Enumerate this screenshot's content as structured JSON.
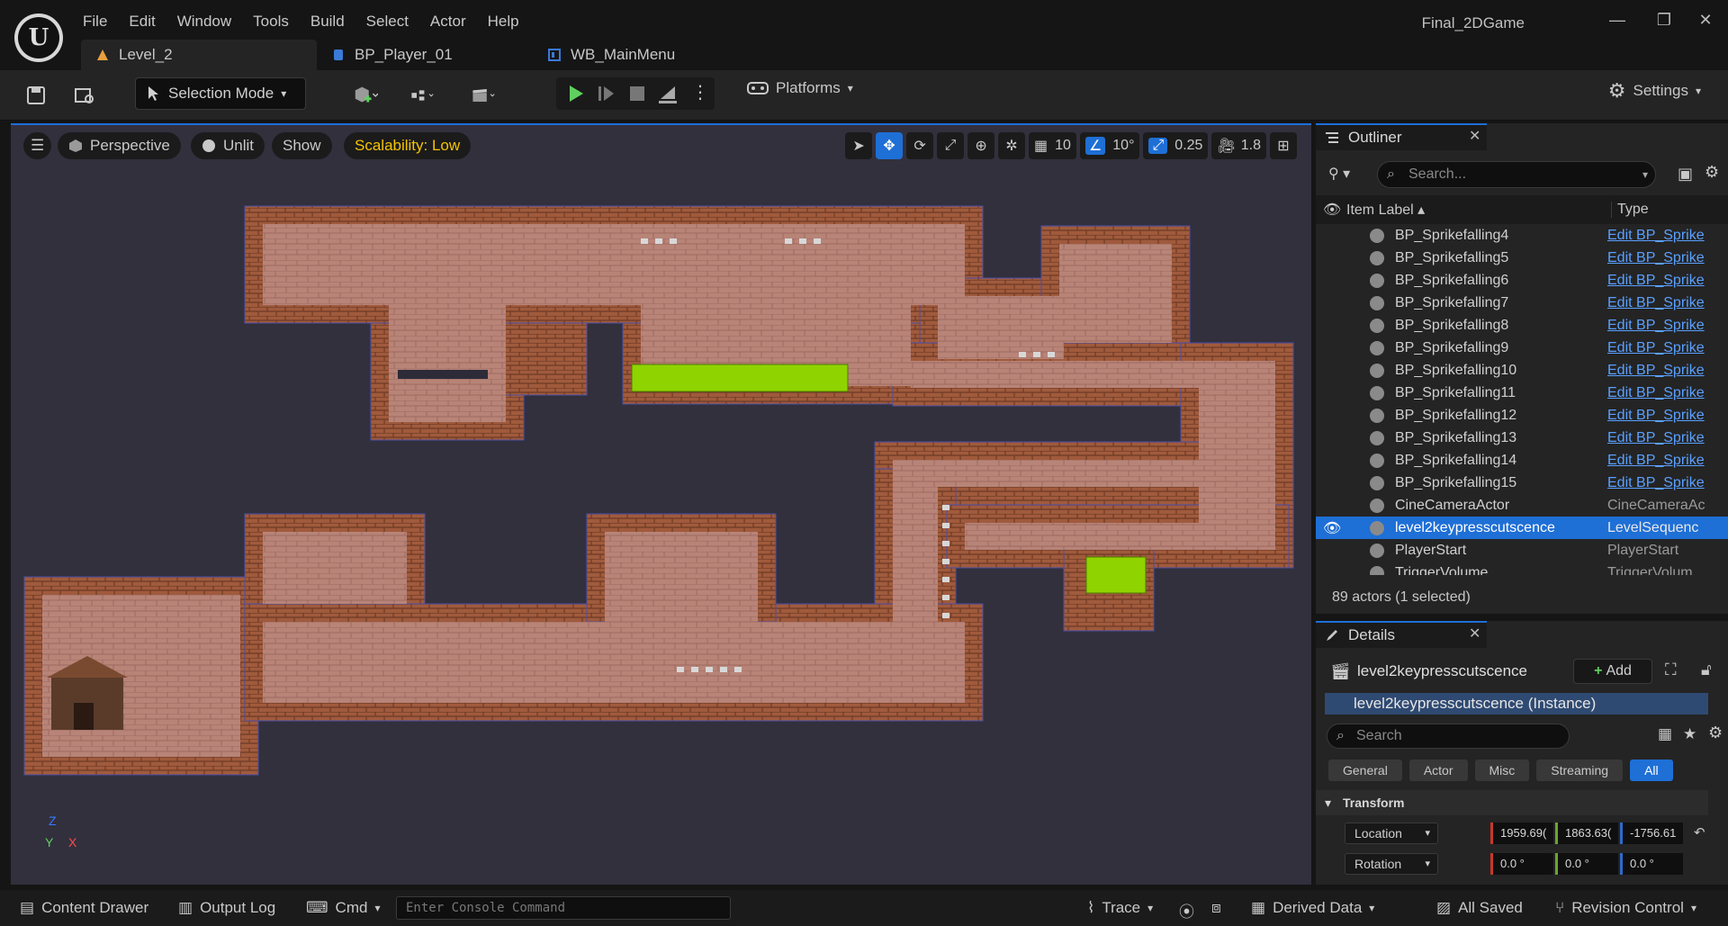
{
  "menu": [
    "File",
    "Edit",
    "Window",
    "Tools",
    "Build",
    "Select",
    "Actor",
    "Help"
  ],
  "project_name": "Final_2DGame",
  "doc_tabs": [
    "Level_2",
    "BP_Player_01",
    "WB_MainMenu"
  ],
  "toolbar": {
    "selection_mode": "Selection Mode",
    "platforms": "Platforms",
    "settings": "Settings"
  },
  "viewport": {
    "perspective": "Perspective",
    "unlit": "Unlit",
    "show": "Show",
    "scalability": "Scalability: Low",
    "grid_snap": "10",
    "rot_snap": "10°",
    "scale_snap": "0.25",
    "camera_speed": "1.8"
  },
  "outliner": {
    "title": "Outliner",
    "search_placeholder": "Search...",
    "col_label": "Item Label",
    "col_type": "Type",
    "rows": [
      {
        "label": "BP_Sprikefalling4",
        "type": "Edit BP_Sprike",
        "link": true
      },
      {
        "label": "BP_Sprikefalling5",
        "type": "Edit BP_Sprike",
        "link": true
      },
      {
        "label": "BP_Sprikefalling6",
        "type": "Edit BP_Sprike",
        "link": true
      },
      {
        "label": "BP_Sprikefalling7",
        "type": "Edit BP_Sprike",
        "link": true
      },
      {
        "label": "BP_Sprikefalling8",
        "type": "Edit BP_Sprike",
        "link": true
      },
      {
        "label": "BP_Sprikefalling9",
        "type": "Edit BP_Sprike",
        "link": true
      },
      {
        "label": "BP_Sprikefalling10",
        "type": "Edit BP_Sprike",
        "link": true
      },
      {
        "label": "BP_Sprikefalling11",
        "type": "Edit BP_Sprike",
        "link": true
      },
      {
        "label": "BP_Sprikefalling12",
        "type": "Edit BP_Sprike",
        "link": true
      },
      {
        "label": "BP_Sprikefalling13",
        "type": "Edit BP_Sprike",
        "link": true
      },
      {
        "label": "BP_Sprikefalling14",
        "type": "Edit BP_Sprike",
        "link": true
      },
      {
        "label": "BP_Sprikefalling15",
        "type": "Edit BP_Sprike",
        "link": true
      },
      {
        "label": "CineCameraActor",
        "type": "CineCameraAc",
        "link": false
      },
      {
        "label": "level2keypresscutscence",
        "type": "LevelSequenc",
        "link": false,
        "selected": true
      },
      {
        "label": "PlayerStart",
        "type": "PlayerStart",
        "link": false
      },
      {
        "label": "TriggerVolume",
        "type": "TriggerVolum",
        "link": false
      }
    ],
    "actor_count": "89 actors (1 selected)"
  },
  "details": {
    "title": "Details",
    "actor_name": "level2keypresscutscence",
    "add_label": "Add",
    "instance": "level2keypresscutscence (Instance)",
    "search_placeholder": "Search",
    "filters": [
      "General",
      "Actor",
      "Misc",
      "Streaming",
      "All"
    ],
    "transform_header": "Transform",
    "location_label": "Location",
    "location": [
      "1959.69(",
      "1863.63(",
      "-1756.61"
    ],
    "rotation_label": "Rotation",
    "rotation": [
      "0.0 °",
      "0.0 °",
      "0.0 °"
    ]
  },
  "bottom": {
    "content_drawer": "Content Drawer",
    "output_log": "Output Log",
    "cmd": "Cmd",
    "console_placeholder": "Enter Console Command",
    "trace": "Trace",
    "derived_data": "Derived Data",
    "all_saved": "All Saved",
    "revision_control": "Revision Control"
  },
  "colors": {
    "accent": "#1e6fd6",
    "brick": "#b97a6e",
    "viewport_bg": "#32303d",
    "acid": "#8fd400"
  }
}
